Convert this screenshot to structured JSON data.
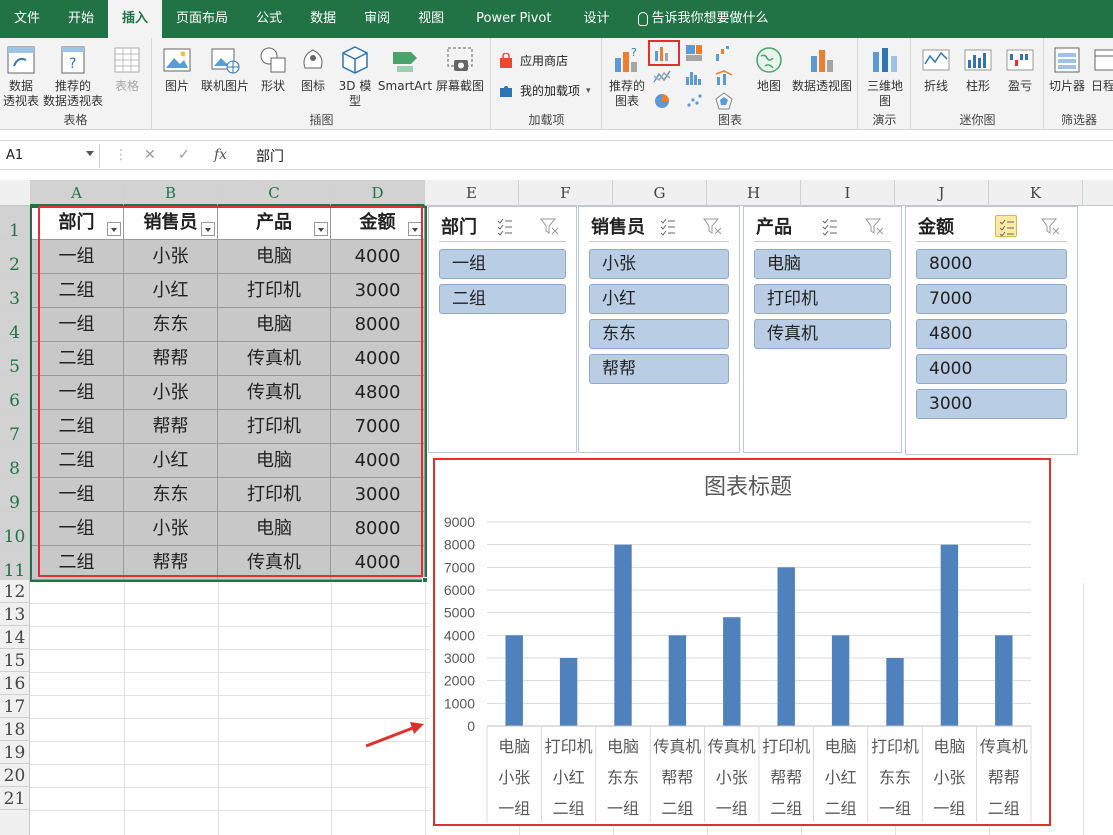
{
  "tabs": [
    "文件",
    "开始",
    "插入",
    "页面布局",
    "公式",
    "数据",
    "审阅",
    "视图",
    "Power Pivot",
    "设计"
  ],
  "active_tab": "插入",
  "tell_me": "告诉我你想要做什么",
  "ribbon": {
    "tables": {
      "label": "表格",
      "pivot": "数据\n透视表",
      "recommended_pivot": "推荐的\n数据透视表",
      "table": "表格"
    },
    "illustrations": {
      "label": "插图",
      "picture": "图片",
      "online_picture": "联机图片",
      "shapes": "形状",
      "icons": "图标",
      "model3d": "3D 模\n型",
      "smartart": "SmartArt",
      "screenshot": "屏幕截图"
    },
    "addins": {
      "label": "加载项",
      "store": "应用商店",
      "my_addins": "我的加载项"
    },
    "charts": {
      "label": "图表",
      "recommended": "推荐的\n图表",
      "maps": "地图",
      "pivotchart": "数据透视图"
    },
    "tours": {
      "label": "演示",
      "map3d": "三维地\n图"
    },
    "sparklines": {
      "label": "迷你图",
      "line": "折线",
      "column": "柱形",
      "winloss": "盈亏"
    },
    "filters": {
      "label": "筛选器",
      "slicer": "切片器",
      "timeline": "日程"
    }
  },
  "formula_bar": {
    "name_box": "A1",
    "content": "部门"
  },
  "columns": [
    "A",
    "B",
    "C",
    "D",
    "E",
    "F",
    "G",
    "H",
    "I",
    "J",
    "K"
  ],
  "rows": [
    "1",
    "2",
    "3",
    "4",
    "5",
    "6",
    "7",
    "8",
    "9",
    "10",
    "11",
    "12",
    "13",
    "14",
    "15",
    "16",
    "17",
    "18",
    "19",
    "20",
    "21"
  ],
  "table": {
    "headers": [
      "部门",
      "销售员",
      "产品",
      "金额"
    ],
    "rows": [
      [
        "一组",
        "小张",
        "电脑",
        "4000"
      ],
      [
        "二组",
        "小红",
        "打印机",
        "3000"
      ],
      [
        "一组",
        "东东",
        "电脑",
        "8000"
      ],
      [
        "二组",
        "帮帮",
        "传真机",
        "4000"
      ],
      [
        "一组",
        "小张",
        "传真机",
        "4800"
      ],
      [
        "二组",
        "帮帮",
        "打印机",
        "7000"
      ],
      [
        "二组",
        "小红",
        "电脑",
        "4000"
      ],
      [
        "一组",
        "东东",
        "打印机",
        "3000"
      ],
      [
        "一组",
        "小张",
        "电脑",
        "8000"
      ],
      [
        "二组",
        "帮帮",
        "传真机",
        "4000"
      ]
    ]
  },
  "slicers": [
    {
      "title": "部门",
      "items": [
        "一组",
        "二组"
      ]
    },
    {
      "title": "销售员",
      "items": [
        "小张",
        "小红",
        "东东",
        "帮帮"
      ]
    },
    {
      "title": "产品",
      "items": [
        "电脑",
        "打印机",
        "传真机"
      ]
    },
    {
      "title": "金额",
      "items": [
        "8000",
        "7000",
        "4800",
        "4000",
        "3000"
      ]
    }
  ],
  "colors": {
    "accent": "#217346",
    "bar": "#4f81bd",
    "highlight": "#e03030",
    "slicer_item": "#b9cde5"
  },
  "chart_data": {
    "type": "bar",
    "title": "图表标题",
    "categories": [
      [
        "电脑",
        "小张",
        "一组"
      ],
      [
        "打印机",
        "小红",
        "二组"
      ],
      [
        "电脑",
        "东东",
        "一组"
      ],
      [
        "传真机",
        "帮帮",
        "二组"
      ],
      [
        "传真机",
        "小张",
        "一组"
      ],
      [
        "打印机",
        "帮帮",
        "二组"
      ],
      [
        "电脑",
        "小红",
        "二组"
      ],
      [
        "打印机",
        "东东",
        "一组"
      ],
      [
        "电脑",
        "小张",
        "一组"
      ],
      [
        "传真机",
        "帮帮",
        "二组"
      ]
    ],
    "values": [
      4000,
      3000,
      8000,
      4000,
      4800,
      7000,
      4000,
      3000,
      8000,
      4000
    ],
    "yticks": [
      "0",
      "1000",
      "2000",
      "3000",
      "4000",
      "5000",
      "6000",
      "7000",
      "8000",
      "9000"
    ],
    "ylim": [
      0,
      9000
    ],
    "grid": true,
    "legend": "none"
  }
}
